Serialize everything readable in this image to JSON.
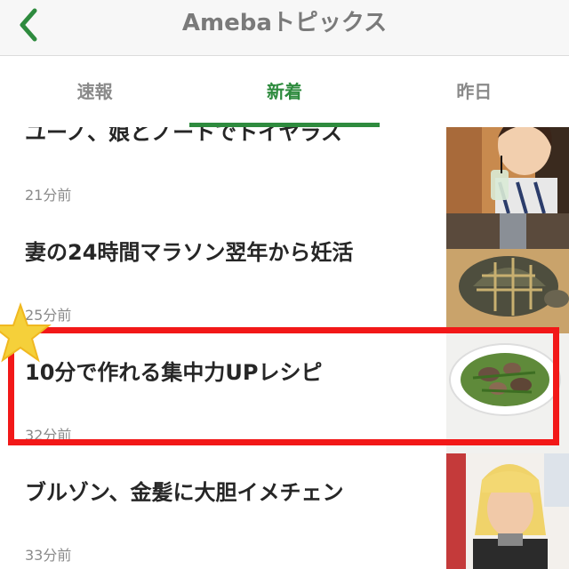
{
  "header": {
    "title": "Amebaトピックス",
    "back_icon": "chevron-left-icon"
  },
  "tabs": [
    {
      "label": "速報",
      "active": false
    },
    {
      "label": "新着",
      "active": true
    },
    {
      "label": "昨日",
      "active": false
    }
  ],
  "feed": {
    "items": [
      {
        "title": "ユーノ、娘とノートでトイヤラス",
        "time": "21分前",
        "thumb": "child-drinking-photo"
      },
      {
        "title": "妻の24時間マラソン翌年から妊活",
        "time": "25分前",
        "thumb": "tortoise-photo"
      },
      {
        "title": "10分で作れる集中力UPレシピ",
        "time": "32分前",
        "thumb": "clam-stirfry-photo"
      },
      {
        "title": "ブルゾン、金髪に大胆イメチェン",
        "time": "33分前",
        "thumb": "blonde-woman-photo"
      }
    ]
  },
  "colors": {
    "accent": "#2e8b3e",
    "highlight": "#f21818",
    "star": "#f5d03a"
  }
}
